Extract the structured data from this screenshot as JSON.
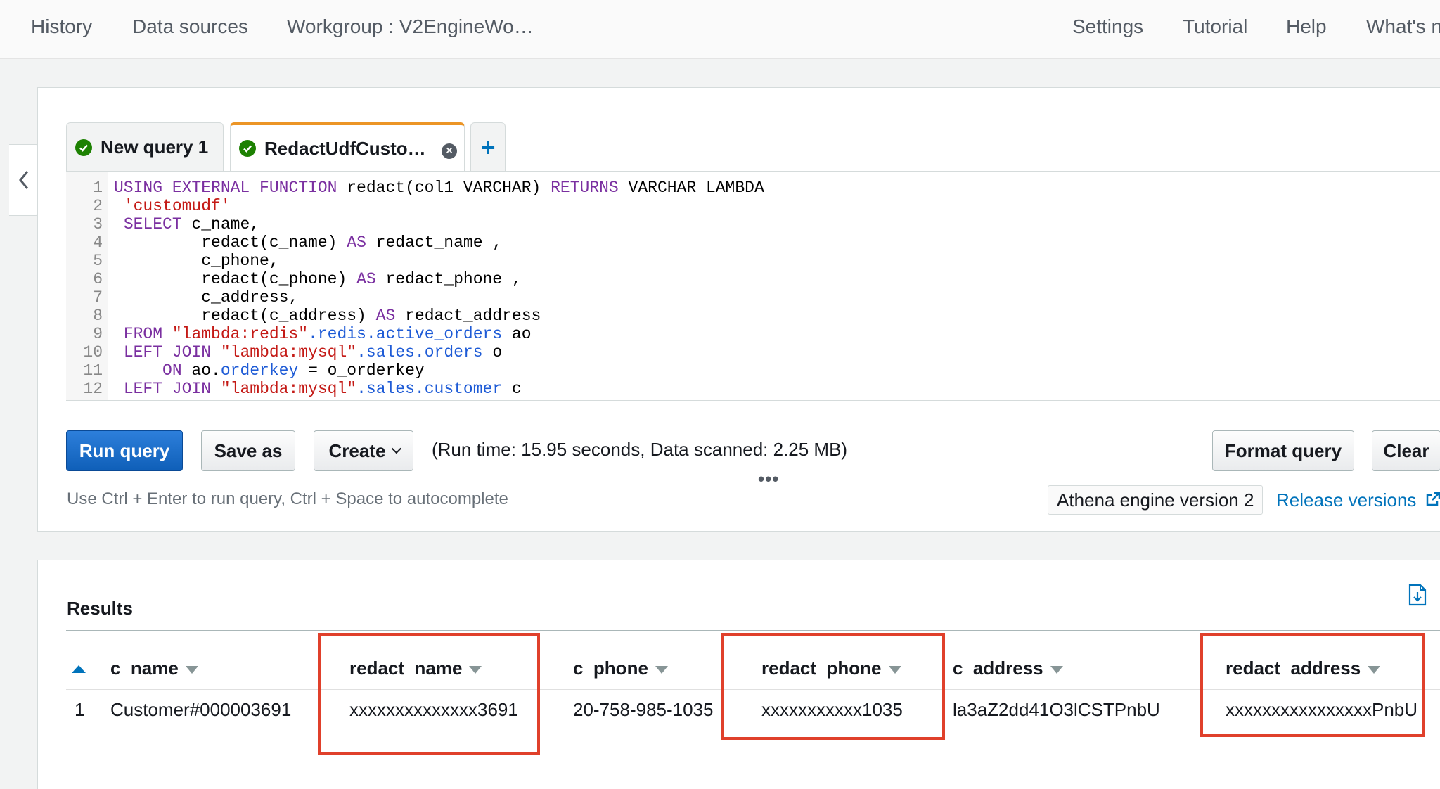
{
  "topnav": {
    "left": [
      "History",
      "Data sources",
      "Workgroup : V2EngineWo…"
    ],
    "right": [
      "Settings",
      "Tutorial",
      "Help",
      "What's n"
    ]
  },
  "tabs": [
    {
      "label": "New query 1"
    },
    {
      "label": "RedactUdfCusto…"
    }
  ],
  "editor": {
    "line_numbers": [
      "1",
      "2",
      "3",
      "4",
      "5",
      "6",
      "7",
      "8",
      "9",
      "10",
      "11",
      "12"
    ]
  },
  "toolbar": {
    "run_label": "Run query",
    "save_label": "Save as",
    "create_label": "Create",
    "run_info": "(Run time: 15.95 seconds, Data scanned: 2.25 MB)",
    "format_label": "Format query",
    "clear_label": "Clear",
    "hint": "Use Ctrl + Enter to run query, Ctrl + Space to autocomplete",
    "engine": "Athena engine version 2",
    "release_link": "Release versions"
  },
  "results": {
    "title": "Results",
    "columns": [
      "c_name",
      "redact_name",
      "c_phone",
      "redact_phone",
      "c_address",
      "redact_address"
    ],
    "rows": [
      {
        "num": "1",
        "cells": [
          "Customer#000003691",
          "xxxxxxxxxxxxxx3691",
          "20-758-985-1035",
          "xxxxxxxxxxx1035",
          "la3aZ2dd41O3lCSTPnbU",
          "xxxxxxxxxxxxxxxxPnbU"
        ]
      }
    ]
  },
  "colors": {
    "accent": "#0073bb",
    "primary_button": "#1a6fcc",
    "highlight_box": "#e0402b",
    "success": "#1d8102",
    "tab_accent": "#ec9526"
  }
}
